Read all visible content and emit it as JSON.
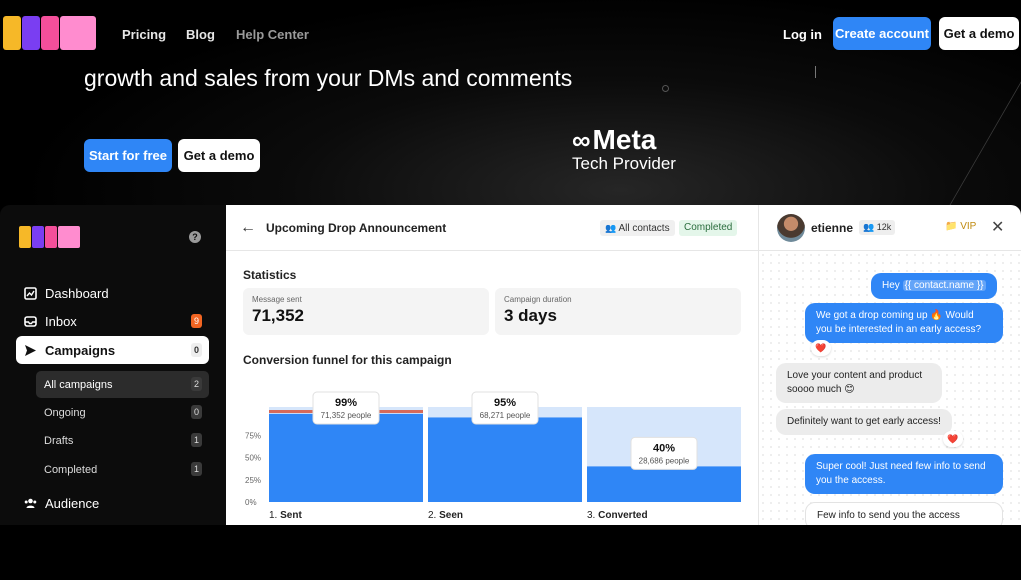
{
  "nav": {
    "links": [
      "Pricing",
      "Blog",
      "Help Center"
    ],
    "login": "Log in",
    "create_account": "Create account",
    "get_demo": "Get a demo"
  },
  "hero": {
    "headline": "growth and sales from your DMs and comments",
    "start_free": "Start for free",
    "get_demo": "Get a demo",
    "meta_word": "Meta",
    "meta_sub": "Tech Provider"
  },
  "colors": {
    "accent": "#2f86f6",
    "logo": [
      "#f6b828",
      "#7a3ef2",
      "#f44f9a",
      "#ff8ccf"
    ]
  },
  "sidebar": {
    "help_icon": "question-icon",
    "items": [
      {
        "label": "Dashboard",
        "icon": "chart-icon"
      },
      {
        "label": "Inbox",
        "icon": "inbox-icon",
        "badge": "9"
      },
      {
        "label": "Campaigns",
        "icon": "send-icon",
        "badge": "0"
      }
    ],
    "sub_items": [
      {
        "label": "All campaigns",
        "badge": "2"
      },
      {
        "label": "Ongoing",
        "badge": "0"
      },
      {
        "label": "Drafts",
        "badge": "1"
      },
      {
        "label": "Completed",
        "badge": "1"
      }
    ],
    "audience": {
      "label": "Audience",
      "icon": "users-icon"
    }
  },
  "campaign": {
    "title": "Upcoming Drop Announcement",
    "audience_pill": "All contacts",
    "status_pill": "Completed",
    "statistics_label": "Statistics",
    "stats": [
      {
        "label": "Message sent",
        "value": "71,352"
      },
      {
        "label": "Campaign duration",
        "value": "3 days"
      }
    ],
    "funnel_label": "Conversion funnel for this campaign"
  },
  "chart_data": {
    "type": "bar",
    "categories": [
      "1. Sent",
      "2. Seen",
      "3. Converted"
    ],
    "values": [
      99,
      95,
      40
    ],
    "value_labels": [
      "99%",
      "95%",
      "40%"
    ],
    "people_labels": [
      "71,352 people",
      "68,271 people",
      "28,686 people"
    ],
    "yticks": [
      "75%",
      "50%",
      "25%",
      "0%"
    ],
    "ylim": [
      0,
      100
    ],
    "bar_color": "#2f86f6",
    "remainder_color": "#d6e6fb"
  },
  "contact": {
    "name": "etienne",
    "followers": "12k",
    "tag": "VIP"
  },
  "chat": {
    "m1_prefix": "Hey ",
    "m1_var": "{{ contact.name }}",
    "m2": "We got a drop coming up 🔥 Would you be interested in an early access?",
    "reaction": "❤️",
    "m3": "Love your content and product soooo much 😊",
    "m4": "Definitely want to get early access!",
    "m5": "Super cool! Just need few info to send you the access.",
    "m6": "Few info to send you the access"
  }
}
